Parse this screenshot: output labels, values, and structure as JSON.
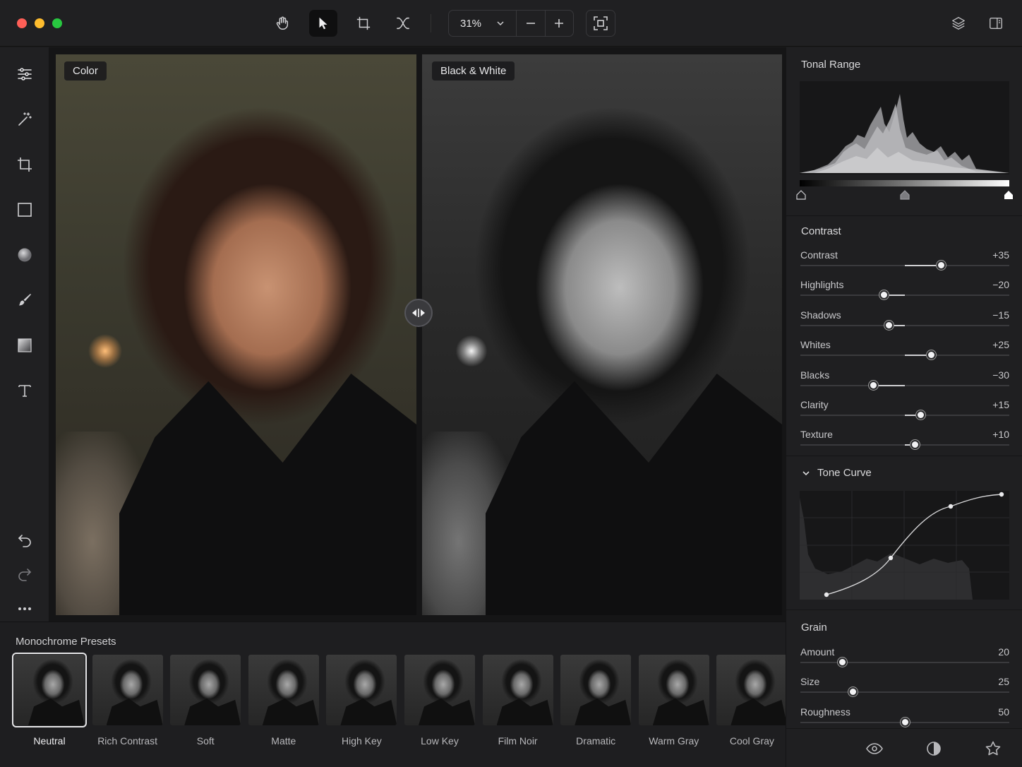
{
  "toolbar": {
    "zoom": "31%",
    "tools": [
      "hand-icon",
      "pointer-icon",
      "crop-icon",
      "transform-icon"
    ],
    "active_tool": "pointer-icon"
  },
  "rail": {
    "items": [
      "adjustments-icon",
      "magic-wand-icon",
      "crop-icon",
      "rectangle-icon",
      "circle-icon",
      "brush-icon",
      "gradient-icon",
      "text-icon"
    ],
    "bottom": [
      "undo-icon",
      "redo-icon",
      "more-icon"
    ]
  },
  "canvas": {
    "left_label": "Color",
    "right_label": "Black & White"
  },
  "presets": {
    "title": "Monochrome Presets",
    "items": [
      "Neutral",
      "Rich Contrast",
      "Soft",
      "Matte",
      "High Key",
      "Low Key",
      "Film Noir",
      "Dramatic",
      "Warm Gray",
      "Cool Gray"
    ],
    "selected": "Neutral"
  },
  "panel": {
    "tonal_range": {
      "title": "Tonal Range"
    },
    "contrast": {
      "title": "Contrast",
      "sliders": [
        {
          "label": "Contrast",
          "value": 35,
          "display": "+35"
        },
        {
          "label": "Highlights",
          "value": -20,
          "display": "−20"
        },
        {
          "label": "Shadows",
          "value": -15,
          "display": "−15"
        },
        {
          "label": "Whites",
          "value": 25,
          "display": "+25"
        },
        {
          "label": "Blacks",
          "value": -30,
          "display": "−30"
        },
        {
          "label": "Clarity",
          "value": 15,
          "display": "+15"
        },
        {
          "label": "Texture",
          "value": 10,
          "display": "+10"
        }
      ]
    },
    "tone_curve": {
      "title": "Tone Curve"
    },
    "grain": {
      "title": "Grain",
      "sliders": [
        {
          "label": "Amount",
          "value": 20,
          "display": "20"
        },
        {
          "label": "Size",
          "value": 25,
          "display": "25"
        },
        {
          "label": "Roughness",
          "value": 50,
          "display": "50"
        }
      ]
    },
    "footer": [
      "eye-icon",
      "contrast-circle-icon",
      "star-icon"
    ]
  },
  "colors": {
    "accent": "#f2f2f4",
    "background": "#1b1b1d",
    "panel": "#1f1f21"
  }
}
